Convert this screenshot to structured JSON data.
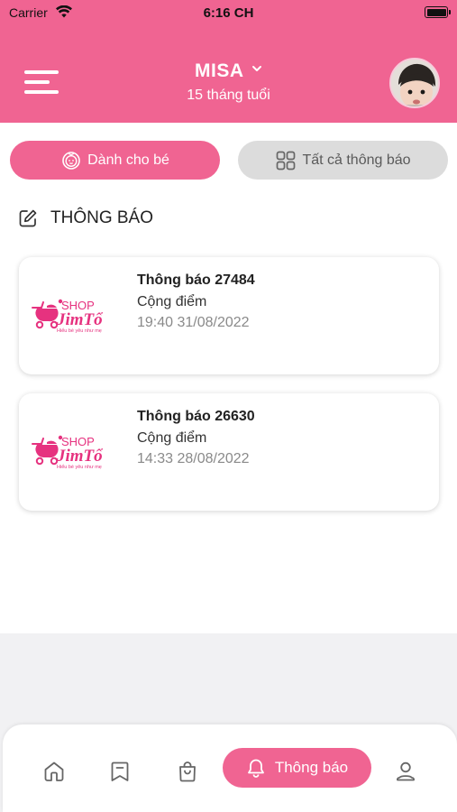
{
  "status_bar": {
    "carrier": "Carrier",
    "time": "6:16 CH"
  },
  "header": {
    "child_name": "MISA",
    "child_age": "15 tháng tuổi",
    "accent_color": "#f06492"
  },
  "tabs": {
    "for_baby": "Dành cho bé",
    "all_notifications": "Tất cả thông báo"
  },
  "section": {
    "title": "THÔNG BÁO"
  },
  "notifications": [
    {
      "title": "Thông báo 27484",
      "type": "Cộng điểm",
      "time": "19:40 31/08/2022",
      "logo_shop": "SHOP",
      "logo_brand": "JimTổ",
      "logo_tagline": "Hiểu bé yêu như mẹ"
    },
    {
      "title": "Thông báo 26630",
      "type": "Cộng điểm",
      "time": "14:33 28/08/2022",
      "logo_shop": "SHOP",
      "logo_brand": "JimTổ",
      "logo_tagline": "Hiểu bé yêu như mẹ"
    }
  ],
  "bottom_nav": {
    "items": [
      "home-icon",
      "bookmark-icon",
      "shopping-bag-icon",
      "bell-icon",
      "user-icon"
    ],
    "active_label": "Thông báo"
  }
}
